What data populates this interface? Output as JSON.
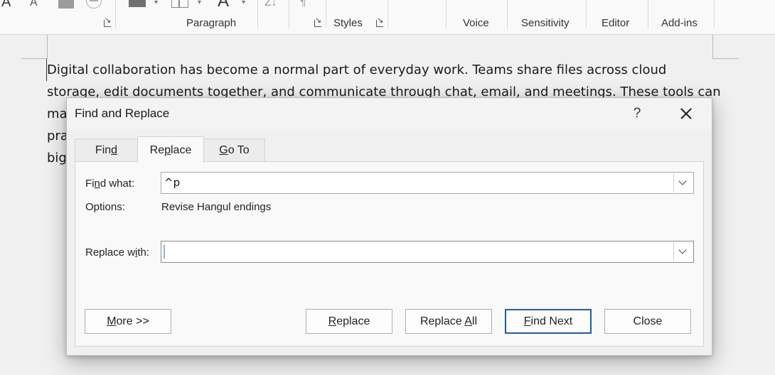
{
  "ribbon": {
    "groups": [
      {
        "label": "Paragraph"
      },
      {
        "label": "Styles"
      },
      {
        "label": "Voice"
      },
      {
        "label": "Sensitivity"
      },
      {
        "label": "Editor"
      },
      {
        "label": "Add-ins"
      }
    ],
    "font_glyph_large": "A",
    "font_glyph_small": "A",
    "sort_glyph": "Z↓",
    "pilcrow_glyph": "¶",
    "text_effects_glyph": "A"
  },
  "document": {
    "lines": [
      "Digital collaboration has become a normal part of everyday work. Teams share files across cloud",
      "storage, edit documents together, and communicate through chat, email, and meetings. These tools can",
      "ma",
      "pra",
      "big"
    ]
  },
  "dialog": {
    "title": "Find and Replace",
    "help_label": "?",
    "tabs": [
      {
        "pre": "Fin",
        "key": "d",
        "post": ""
      },
      {
        "pre": "Re",
        "key": "p",
        "post": "lace"
      },
      {
        "pre": "",
        "key": "G",
        "post": "o To"
      }
    ],
    "find_what": {
      "label_pre": "Fi",
      "label_key": "n",
      "label_post": "d what:",
      "value": "^p"
    },
    "options": {
      "label": "Options:",
      "value": "Revise Hangul endings"
    },
    "replace_with": {
      "label_pre": "Replace w",
      "label_key": "i",
      "label_post": "th:",
      "value": ""
    },
    "buttons": {
      "more": {
        "key": "M",
        "post": "ore >>"
      },
      "replace": {
        "key": "R",
        "post": "eplace"
      },
      "replace_all": {
        "pre": "Replace ",
        "key": "A",
        "post": "ll"
      },
      "find_next": {
        "key": "F",
        "post": "ind Next"
      },
      "close": {
        "label": "Close"
      }
    }
  }
}
